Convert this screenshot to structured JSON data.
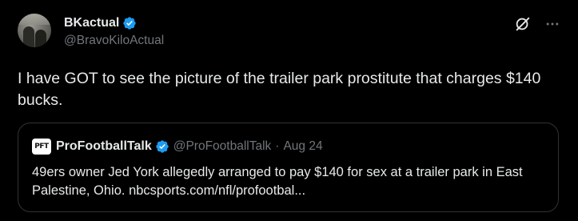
{
  "post": {
    "author": {
      "display_name": "BKactual",
      "handle": "@BravoKiloActual",
      "verified": true,
      "avatar_icon": "avatar-photo"
    },
    "actions": {
      "grok_icon": "grok-icon",
      "more_icon": "more-icon"
    },
    "text": "I have GOT to see the picture of the trailer park prostitute that charges $140 bucks.",
    "quote": {
      "avatar_text": "PFT",
      "display_name": "ProFootballTalk",
      "handle": "@ProFootballTalk",
      "separator": "·",
      "date": "Aug 24",
      "verified": true,
      "text": "49ers owner Jed York allegedly arranged to pay $140 for sex at a trailer park in East Palestine, Ohio. nbcsports.com/nfl/profootbal..."
    }
  },
  "colors": {
    "background": "#000000",
    "primary_text": "#e7e9ea",
    "secondary_text": "#71767b",
    "border": "#2f3336",
    "verified_blue": "#1d9bf0"
  }
}
